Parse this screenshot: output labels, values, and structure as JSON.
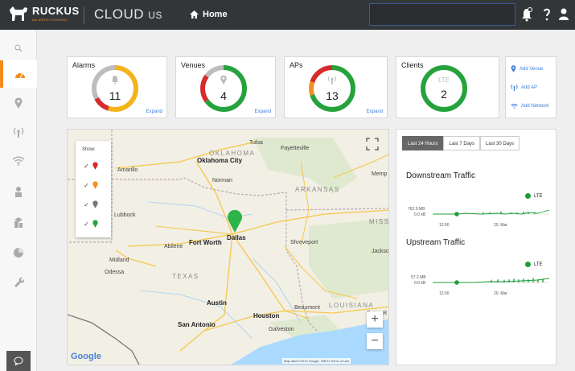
{
  "header": {
    "logo_text": "RUCKUS",
    "logo_tagline": "AN ARRIS COMPANY",
    "product_name": "CLOUD",
    "region": "US",
    "home_label": "Home"
  },
  "sidebar": {
    "items": [
      {
        "icon": "search-icon"
      },
      {
        "icon": "dashboard-icon",
        "active": true
      },
      {
        "icon": "location-pin-icon"
      },
      {
        "icon": "access-point-icon"
      },
      {
        "icon": "wifi-icon"
      },
      {
        "icon": "user-icon"
      },
      {
        "icon": "layers-icon"
      },
      {
        "icon": "pie-chart-icon"
      },
      {
        "icon": "wrench-icon"
      }
    ],
    "chat_icon": "chat-icon"
  },
  "summary": {
    "alarms": {
      "title": "Alarms",
      "value": "11",
      "expand": "Expand",
      "segments": [
        {
          "color": "#f4b31b",
          "fraction": 0.55
        },
        {
          "color": "#d42b2b",
          "fraction": 0.12
        },
        {
          "color": "#bdbdbd",
          "fraction": 0.33
        }
      ]
    },
    "venues": {
      "title": "Venues",
      "value": "4",
      "expand": "Expand",
      "segments": [
        {
          "color": "#26a23c",
          "fraction": 0.65
        },
        {
          "color": "#d42b2b",
          "fraction": 0.2
        },
        {
          "color": "#bdbdbd",
          "fraction": 0.15
        }
      ]
    },
    "aps": {
      "title": "APs",
      "value": "13",
      "expand": "Expand",
      "segments": [
        {
          "color": "#26a23c",
          "fraction": 0.7
        },
        {
          "color": "#f4901e",
          "fraction": 0.1
        },
        {
          "color": "#d42b2b",
          "fraction": 0.2
        }
      ]
    },
    "clients": {
      "title": "Clients",
      "value": "2",
      "sublabel": "LTE",
      "segments": [
        {
          "color": "#26a23c",
          "fraction": 1.0
        }
      ]
    }
  },
  "quick_links": [
    {
      "label": "Add Venue",
      "icon": "location-pin-icon"
    },
    {
      "label": "Add AP",
      "icon": "access-point-icon"
    },
    {
      "label": "Add Network",
      "icon": "wifi-icon"
    }
  ],
  "map": {
    "show_title": "Show:",
    "filters": [
      {
        "color": "#d42b2b",
        "checked": true
      },
      {
        "color": "#f4901e",
        "checked": true
      },
      {
        "color": "#777777",
        "checked": true
      },
      {
        "color": "#26a23c",
        "checked": true
      }
    ],
    "states": [
      "OKLAHOMA",
      "ARKANSAS",
      "TEXAS",
      "LOUISIANA",
      "MISS"
    ],
    "cities": [
      "Tulsa",
      "Fayetteville",
      "Oklahoma City",
      "Norman",
      "Amarillo",
      "Memp",
      "Lubbock",
      "Dallas",
      "Fort Worth",
      "Abilene",
      "Shreveport",
      "Jackso",
      "Midland",
      "Odessa",
      "Austin",
      "Houston",
      "San Antonio",
      "Beaumont",
      "Baton R",
      "Galveston"
    ],
    "attribution": "Map data ©2019 Google, INEGI   Terms of Use",
    "google": "Google",
    "zoom_in": "+",
    "zoom_out": "−"
  },
  "traffic": {
    "tabs": [
      "Last 24 Hours",
      "Last 7 Days",
      "Last 30 Days"
    ],
    "active_tab": 0,
    "legend": "LTE",
    "downstream": {
      "title": "Downstream Traffic",
      "max_label": "762.9 MB",
      "min_label": "0.0 kB",
      "x_labels": [
        "12:00",
        "20. Mar"
      ]
    },
    "upstream": {
      "title": "Upstream Traffic",
      "max_label": "57.2 MB",
      "min_label": "0.0 kB",
      "x_labels": [
        "12:00",
        "20. Mar"
      ]
    }
  }
}
